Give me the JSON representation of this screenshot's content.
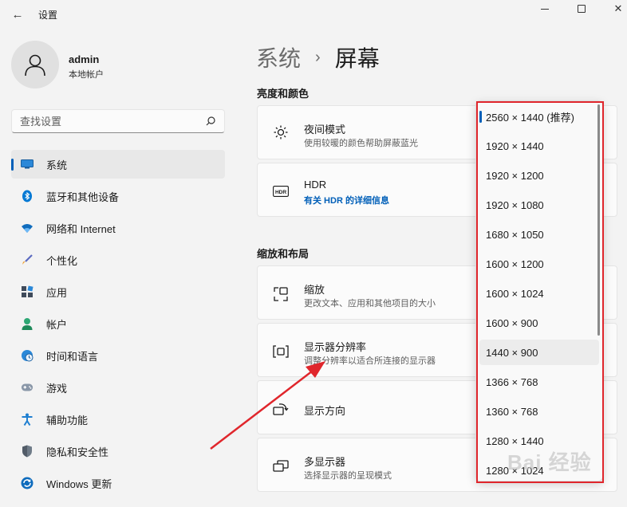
{
  "window": {
    "title": "设置",
    "back_glyph": "←",
    "minimize_glyph": "",
    "close_glyph": "✕"
  },
  "user": {
    "name": "admin",
    "account_type": "本地帐户"
  },
  "search": {
    "placeholder": "查找设置"
  },
  "sidebar": {
    "items": [
      {
        "label": "系统",
        "icon": "display-icon",
        "active": true
      },
      {
        "label": "蓝牙和其他设备",
        "icon": "bluetooth-icon"
      },
      {
        "label": "网络和 Internet",
        "icon": "wifi-icon"
      },
      {
        "label": "个性化",
        "icon": "brush-icon"
      },
      {
        "label": "应用",
        "icon": "apps-icon"
      },
      {
        "label": "帐户",
        "icon": "person-icon"
      },
      {
        "label": "时间和语言",
        "icon": "globe-clock-icon"
      },
      {
        "label": "游戏",
        "icon": "gamepad-icon"
      },
      {
        "label": "辅助功能",
        "icon": "accessibility-icon"
      },
      {
        "label": "隐私和安全性",
        "icon": "shield-icon"
      },
      {
        "label": "Windows 更新",
        "icon": "update-icon"
      }
    ]
  },
  "breadcrumb": {
    "parent": "系统",
    "separator": "›",
    "current": "屏幕"
  },
  "sections": {
    "brightness_color": {
      "title": "亮度和颜色",
      "night_light": {
        "title": "夜间模式",
        "subtitle": "使用较暖的颜色帮助屏蔽蓝光"
      },
      "hdr": {
        "title": "HDR",
        "link": "有关 HDR 的详细信息"
      }
    },
    "scale_layout": {
      "title": "缩放和布局",
      "scale": {
        "title": "缩放",
        "subtitle": "更改文本、应用和其他项目的大小"
      },
      "resolution": {
        "title": "显示器分辨率",
        "subtitle": "调整分辨率以适合所连接的显示器"
      },
      "orientation": {
        "title": "显示方向"
      }
    },
    "multiple_displays": {
      "title": "多显示器",
      "subtitle": "选择显示器的呈现模式"
    }
  },
  "resolution_dropdown": {
    "options": [
      "2560 × 1440 (推荐)",
      "1920 × 1440",
      "1920 × 1200",
      "1920 × 1080",
      "1680 × 1050",
      "1600 × 1200",
      "1600 × 1024",
      "1600 × 900",
      "1440 × 900",
      "1366 × 768",
      "1360 × 768",
      "1280 × 1440",
      "1280 × 1024"
    ],
    "selected_index": 0,
    "hover_index": 8
  },
  "watermark": {
    "text": "Bai 经验"
  },
  "colors": {
    "accent": "#005fb8",
    "highlight_frame": "#e0262c",
    "annotation_arrow": "#e0262c"
  }
}
